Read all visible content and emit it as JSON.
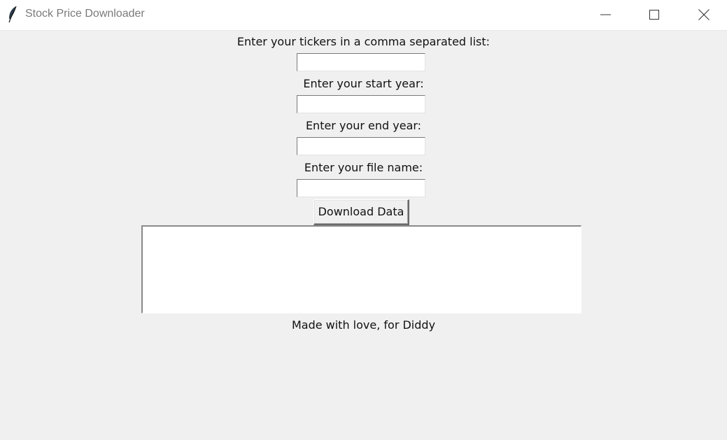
{
  "window": {
    "title": "Stock Price Downloader"
  },
  "form": {
    "tickers_label": "Enter your tickers in a comma separated list:",
    "tickers_value": "",
    "start_label": "Enter your start year:",
    "start_value": "",
    "end_label": "Enter your end year:",
    "end_value": "",
    "file_label": "Enter your file name:",
    "file_value": "",
    "download_button": "Download Data"
  },
  "output": {
    "text": ""
  },
  "footer": {
    "credit": "Made with love, for Diddy"
  },
  "icons": {
    "app": "feather-icon",
    "minimize": "minimize-icon",
    "maximize": "maximize-icon",
    "close": "close-icon"
  }
}
